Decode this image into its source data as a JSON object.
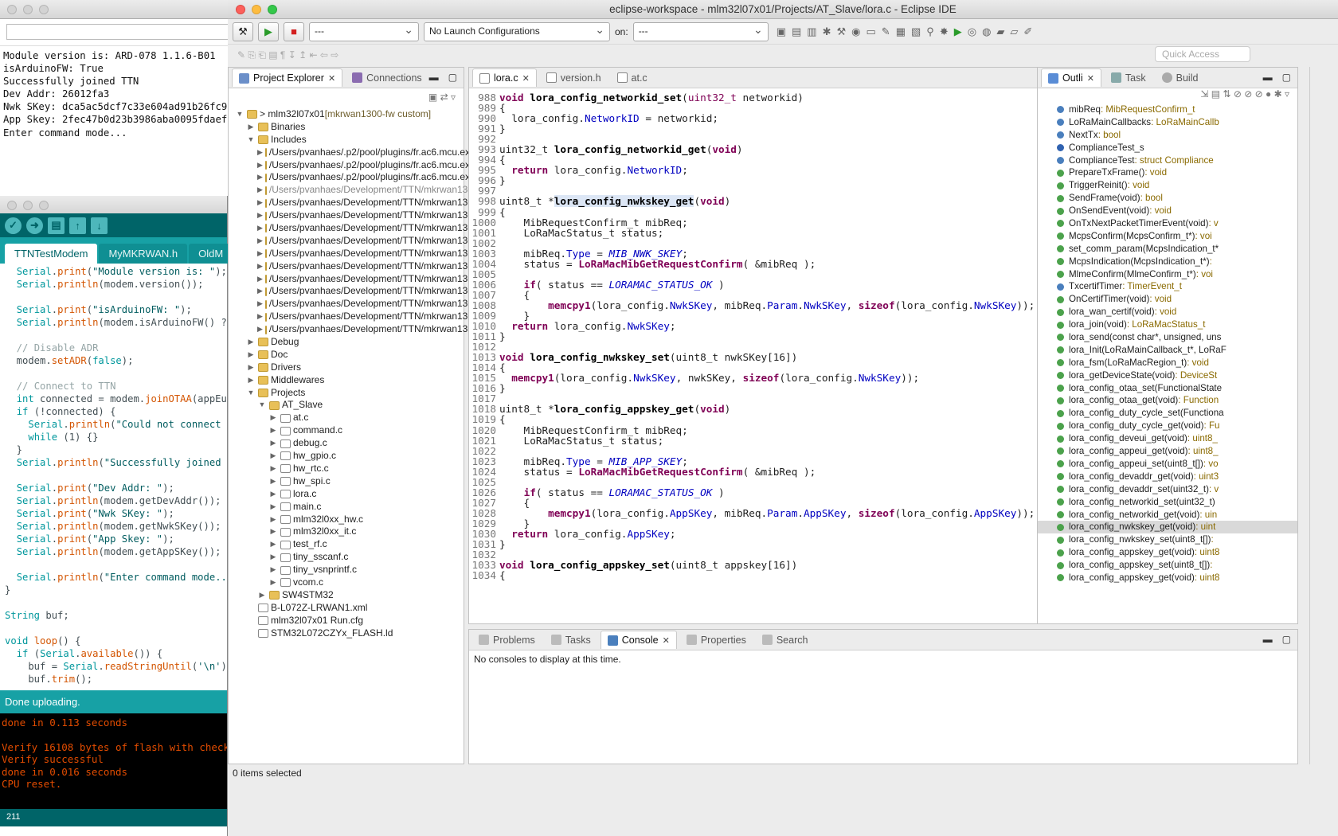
{
  "serial": {
    "output": [
      "Module version is: ARD-078 1.1.6-B01",
      "isArduinoFW: True",
      "Successfully joined TTN",
      "Dev Addr: 26012fa3",
      "Nwk SKey: dca5ac5dcf7c33e604ad91b26fc930",
      "App Skey: 2fec47b0d23b3986aba0095fdaef97",
      "Enter command mode..."
    ]
  },
  "arduino": {
    "tabs": [
      "TTNTestModem",
      "MyMKRWAN.h",
      "OldM"
    ],
    "status": "Done uploading.",
    "console": [
      "done in 0.113 seconds",
      "",
      "Verify 16108 bytes of flash with checksum",
      "Verify successful",
      "done in 0.016 seconds",
      "CPU reset."
    ],
    "line": "211"
  },
  "eclipse": {
    "title": "eclipse-workspace - mlm32l07x01/Projects/AT_Slave/lora.c - Eclipse IDE",
    "launch_mode": "---",
    "launch_config": "No Launch Configurations",
    "on_label": "on:",
    "launch_target": "---",
    "quick_access": "Quick Access",
    "explorer": {
      "tabs": [
        "Project Explorer",
        "Connections"
      ],
      "root": "mlm32l07x01",
      "root_deco": "[mkrwan1300-fw custom]",
      "includes": [
        "/Users/pvanhaes/.p2/pool/plugins/fr.ac6.mcu.exter",
        "/Users/pvanhaes/.p2/pool/plugins/fr.ac6.mcu.exter",
        "/Users/pvanhaes/.p2/pool/plugins/fr.ac6.mcu.exter",
        "/Users/pvanhaes/Development/TTN/mkrwan1300-",
        "/Users/pvanhaes/Development/TTN/mkrwan1300-",
        "/Users/pvanhaes/Development/TTN/mkrwan1300-",
        "/Users/pvanhaes/Development/TTN/mkrwan1300-",
        "/Users/pvanhaes/Development/TTN/mkrwan1300-",
        "/Users/pvanhaes/Development/TTN/mkrwan1300-",
        "/Users/pvanhaes/Development/TTN/mkrwan1300-",
        "/Users/pvanhaes/Development/TTN/mkrwan1300-",
        "/Users/pvanhaes/Development/TTN/mkrwan1300-",
        "/Users/pvanhaes/Development/TTN/mkrwan1300-",
        "/Users/pvanhaes/Development/TTN/mkrwan1300-",
        "/Users/pvanhaes/Development/TTN/mkrwan1300-"
      ],
      "binaries": "Binaries",
      "includes_label": "Includes",
      "folders": [
        "Debug",
        "Doc",
        "Drivers",
        "Middlewares",
        "Projects"
      ],
      "at_slave": "AT_Slave",
      "files": [
        "at.c",
        "command.c",
        "debug.c",
        "hw_gpio.c",
        "hw_rtc.c",
        "hw_spi.c",
        "lora.c",
        "main.c",
        "mlm32l0xx_hw.c",
        "mlm32l0xx_it.c",
        "test_rf.c",
        "tiny_sscanf.c",
        "tiny_vsnprintf.c",
        "vcom.c"
      ],
      "sw4": "SW4STM32",
      "extra": [
        "B-L072Z-LRWAN1.xml",
        "mlm32l07x01 Run.cfg",
        "STM32L072CZYx_FLASH.ld"
      ],
      "status": "0 items selected"
    },
    "editor": {
      "tabs": [
        "lora.c",
        "version.h",
        "at.c"
      ]
    },
    "outline": {
      "tabs": [
        "Outli",
        "Task",
        "Build"
      ],
      "items": [
        [
          "mibReq",
          " : MibRequestConfirm_t"
        ],
        [
          "LoRaMainCallbacks",
          " : LoRaMainCallb"
        ],
        [
          "NextTx",
          " : bool"
        ],
        [
          "ComplianceTest_s",
          ""
        ],
        [
          "ComplianceTest",
          " : struct Compliance"
        ],
        [
          "PrepareTxFrame()",
          " : void"
        ],
        [
          "TriggerReinit()",
          " : void"
        ],
        [
          "SendFrame(void)",
          " : bool"
        ],
        [
          "OnSendEvent(void)",
          " : void"
        ],
        [
          "OnTxNextPacketTimerEvent(void)",
          " : v"
        ],
        [
          "McpsConfirm(McpsConfirm_t*)",
          " : voi"
        ],
        [
          "set_comm_param(McpsIndication_t*",
          " "
        ],
        [
          "McpsIndication(McpsIndication_t*)",
          " :"
        ],
        [
          "MlmeConfirm(MlmeConfirm_t*)",
          " : voi"
        ],
        [
          "TxcertifTimer",
          " : TimerEvent_t"
        ],
        [
          "OnCertifTimer(void)",
          " : void"
        ],
        [
          "lora_wan_certif(void)",
          " : void"
        ],
        [
          "lora_join(void)",
          " : LoRaMacStatus_t"
        ],
        [
          "lora_send(const char*, unsigned, uns",
          ""
        ],
        [
          "lora_Init(LoRaMainCallback_t*, LoRaF",
          ""
        ],
        [
          "lora_fsm(LoRaMacRegion_t)",
          " : void"
        ],
        [
          "lora_getDeviceState(void)",
          " : DeviceSt"
        ],
        [
          "lora_config_otaa_set(FunctionalState",
          ""
        ],
        [
          "lora_config_otaa_get(void)",
          " : Function"
        ],
        [
          "lora_config_duty_cycle_set(Functiona",
          ""
        ],
        [
          "lora_config_duty_cycle_get(void)",
          " : Fu"
        ],
        [
          "lora_config_deveui_get(void)",
          " : uint8_"
        ],
        [
          "lora_config_appeui_get(void)",
          " : uint8_"
        ],
        [
          "lora_config_appeui_set(uint8_t[])",
          " : vo"
        ],
        [
          "lora_config_devaddr_get(void)",
          " : uint3"
        ],
        [
          "lora_config_devaddr_set(uint32_t)",
          " : v"
        ],
        [
          "lora_config_networkid_set(uint32_t)",
          ""
        ],
        [
          "lora_config_networkid_get(void)",
          " : uin"
        ],
        [
          "lora_config_nwkskey_get(void)",
          " : uint"
        ],
        [
          "lora_config_nwkskey_set(uint8_t[])",
          " :"
        ],
        [
          "lora_config_appskey_get(void)",
          " : uint8"
        ],
        [
          "lora_config_appskey_set(uint8_t[])",
          " :"
        ],
        [
          "lora_config_appskey_get(void)",
          " : uint8"
        ]
      ]
    },
    "bottom": {
      "tabs": [
        "Problems",
        "Tasks",
        "Console",
        "Properties",
        "Search"
      ],
      "message": "No consoles to display at this time."
    }
  }
}
